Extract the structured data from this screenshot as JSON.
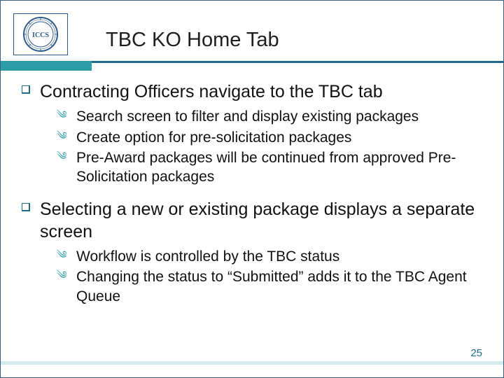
{
  "header": {
    "title": "TBC KO Home Tab",
    "logo_label": "ICCS"
  },
  "bullets": [
    {
      "text": "Contracting Officers navigate to the TBC tab",
      "sub": [
        "Search screen to filter and display existing packages",
        "Create option for pre-solicitation packages",
        "Pre-Award packages will be continued from approved Pre-Solicitation packages"
      ]
    },
    {
      "text": "Selecting a new or existing package displays a separate screen",
      "sub": [
        "Workflow is controlled by the TBC status",
        "Changing the status to “Submitted” adds it to the TBC Agent Queue"
      ]
    }
  ],
  "footer": {
    "page_number": "25"
  },
  "colors": {
    "accent_teal": "#2e9ca6",
    "accent_blue": "#1f6a8a"
  }
}
